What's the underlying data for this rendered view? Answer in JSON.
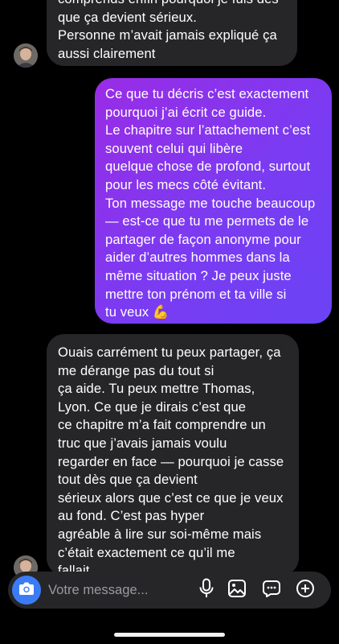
{
  "messages": {
    "top_incoming": {
      "lines": [
        "comprends enfin pourquoi je fuis dès",
        "que ça devient sérieux.",
        "Personne m’avait jamais expliqué ça",
        "aussi clairement"
      ]
    },
    "outgoing": {
      "lines": [
        "Ce que tu décris c’est exactement",
        "pourquoi j’ai écrit ce guide.",
        "Le chapitre sur l’attachement c’est",
        "souvent celui qui libère",
        "quelque chose de profond, surtout",
        "pour les mecs côté évitant.",
        "Ton message me touche beaucoup",
        "— est-ce que tu me permets de le",
        "partager de façon anonyme pour",
        "aider d’autres hommes dans la",
        "même situation ? Je peux juste",
        "mettre ton prénom et ta ville si",
        "tu veux 💪"
      ]
    },
    "bottom_incoming": {
      "lines": [
        "Ouais carrément tu peux partager, ça",
        "me dérange pas du tout si",
        "ça aide. Tu peux mettre Thomas,",
        "Lyon. Ce que je dirais c’est que",
        "ce chapitre m’a fait comprendre un",
        "truc que j’avais jamais voulu",
        "regarder en face — pourquoi je casse",
        "tout dès que ça devient",
        "sérieux alors que c’est ce que je veux",
        "au fond. C’est pas hyper",
        "agréable à lire sur soi-même mais",
        "c’était exactement ce qu’il me",
        "fallait"
      ]
    }
  },
  "composer": {
    "placeholder": "Votre message...",
    "icons": [
      "camera-icon",
      "microphone-icon",
      "gallery-icon",
      "sticker-icon",
      "add-icon"
    ]
  },
  "colors": {
    "background": "#000000",
    "incoming_bubble": "#262629",
    "outgoing_gradient": [
      "#9a2ce6",
      "#6b43f5"
    ],
    "camera_button": "#3b7cf6"
  }
}
